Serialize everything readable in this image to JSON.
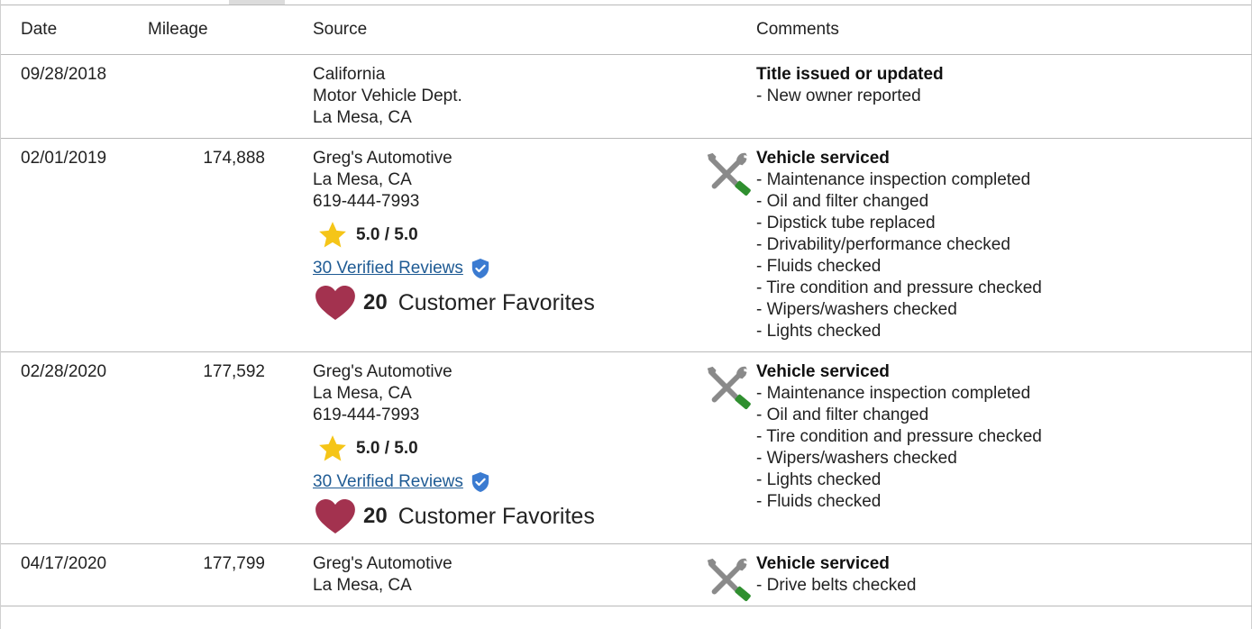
{
  "table": {
    "headers": {
      "date": "Date",
      "mileage": "Mileage",
      "source": "Source",
      "comments": "Comments"
    },
    "rows": [
      {
        "date": "09/28/2018",
        "mileage": "",
        "source_lines": [
          "California",
          "Motor Vehicle Dept.",
          "La Mesa, CA"
        ],
        "comment_title": "Title issued or updated",
        "comment_items": [
          "- New owner reported"
        ]
      },
      {
        "date": "02/01/2019",
        "mileage": "174,888",
        "source_lines": [
          "Greg's Automotive",
          "La Mesa, CA",
          "619-444-7993"
        ],
        "rating": "5.0 / 5.0",
        "reviews_link": "30 Verified Reviews",
        "favorites_count": "20",
        "favorites_label": "Customer Favorites",
        "comment_title": "Vehicle serviced",
        "comment_items": [
          "- Maintenance inspection completed",
          "- Oil and filter changed",
          "- Dipstick tube replaced",
          "- Drivability/performance checked",
          "- Fluids checked",
          "- Tire condition and pressure checked",
          "- Wipers/washers checked",
          "- Lights checked"
        ]
      },
      {
        "date": "02/28/2020",
        "mileage": "177,592",
        "source_lines": [
          "Greg's Automotive",
          "La Mesa, CA",
          "619-444-7993"
        ],
        "rating": "5.0 / 5.0",
        "reviews_link": "30 Verified Reviews",
        "favorites_count": "20",
        "favorites_label": "Customer Favorites",
        "comment_title": "Vehicle serviced",
        "comment_items": [
          "- Maintenance inspection completed",
          "- Oil and filter changed",
          "- Tire condition and pressure checked",
          "- Wipers/washers checked",
          "- Lights checked",
          "- Fluids checked"
        ]
      },
      {
        "date": "04/17/2020",
        "mileage": "177,799",
        "source_lines": [
          "Greg's Automotive",
          "La Mesa, CA"
        ],
        "comment_title": "Vehicle serviced",
        "comment_items": [
          "- Drive belts checked"
        ]
      }
    ]
  },
  "icons": {
    "service": "wrench-screwdriver-icon",
    "rating": "star-icon",
    "verified": "verified-shield-icon",
    "favorite": "heart-icon"
  },
  "colors": {
    "link": "#1f5b94",
    "star": "#f5c518",
    "heart": "#a3324f",
    "shield": "#3b7bd1",
    "tool_gray": "#8a8a8a",
    "tool_green": "#2f8f2f",
    "rule": "#b9b9b9"
  }
}
